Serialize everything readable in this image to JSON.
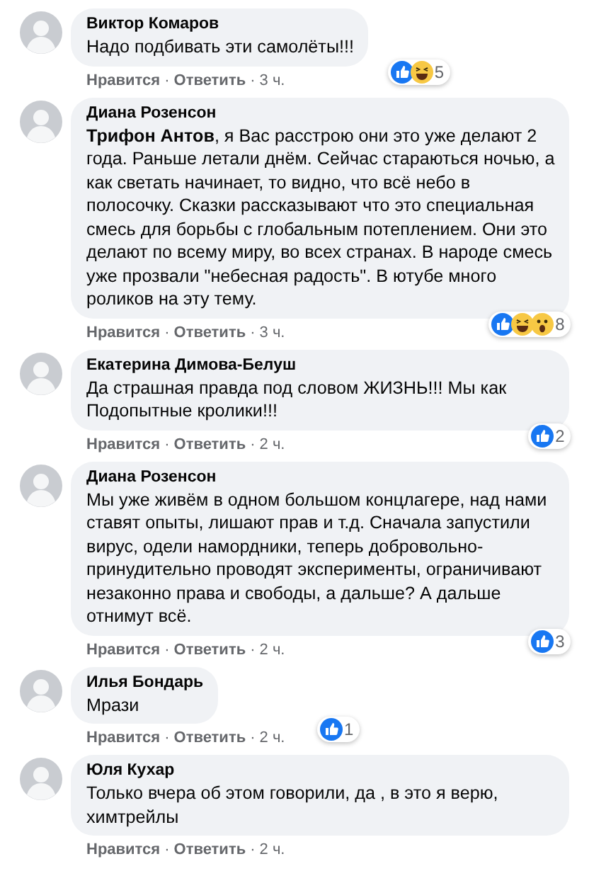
{
  "separator": "·",
  "comments": [
    {
      "author": "Виктор Комаров",
      "text": "Надо подбивать эти самолёты!!!",
      "reactions": [
        {
          "kind": "like"
        },
        {
          "kind": "haha"
        }
      ],
      "reaction_count": "5",
      "actions": [
        "Нравится",
        "Ответить"
      ],
      "time": "3 ч."
    },
    {
      "author": "Диана Розенсон",
      "text": "**Трифон Антов**, я Вас расстрою они это уже делают 2 года. Раньше летали днём. Сейчас стараються ночью, а как светать начинает, то видно, что всё небо в полосочку. Сказки рассказывают что это специальная смесь для борьбы с глобальным потеплением. Они это делают по всему миру, во всех странах. В народе смесь уже прозвали \"небесная радость\". В ютубе много роликов на эту тему.",
      "reactions": [
        {
          "kind": "like"
        },
        {
          "kind": "haha"
        },
        {
          "kind": "wow"
        }
      ],
      "reaction_count": "8",
      "actions": [
        "Нравится",
        "Ответить"
      ],
      "time": "3 ч."
    },
    {
      "author": "Екатерина Димова-Белуш",
      "text": "Да страшная правда под словом ЖИЗНЬ!!! Мы как Подопытные кролики!!!",
      "reactions": [
        {
          "kind": "like"
        }
      ],
      "reaction_count": "2",
      "actions": [
        "Нравится",
        "Ответить"
      ],
      "time": "2 ч."
    },
    {
      "author": "Диана Розенсон",
      "text": "Мы уже живём в одном большом концлагере, над нами ставят опыты, лишают прав и т.д. Сначала запустили вирус, одели намордники, теперь добровольно-принудительно проводят эксперименты, ограничивают незаконно права и свободы, а дальше? А дальше отнимут всё.",
      "reactions": [
        {
          "kind": "like"
        }
      ],
      "reaction_count": "3",
      "actions": [
        "Нравится",
        "Ответить"
      ],
      "time": "2 ч."
    },
    {
      "author": "Илья Бондарь",
      "text": "Мрази",
      "reactions": [
        {
          "kind": "like"
        }
      ],
      "reaction_count": "1",
      "actions": [
        "Нравится",
        "Ответить"
      ],
      "time": "2 ч."
    },
    {
      "author": "Юля Кухар",
      "text": "Только вчера об этом говорили, да , в это я верю, химтрейлы",
      "actions": [
        "Нравится",
        "Ответить"
      ],
      "time": "2 ч."
    }
  ]
}
